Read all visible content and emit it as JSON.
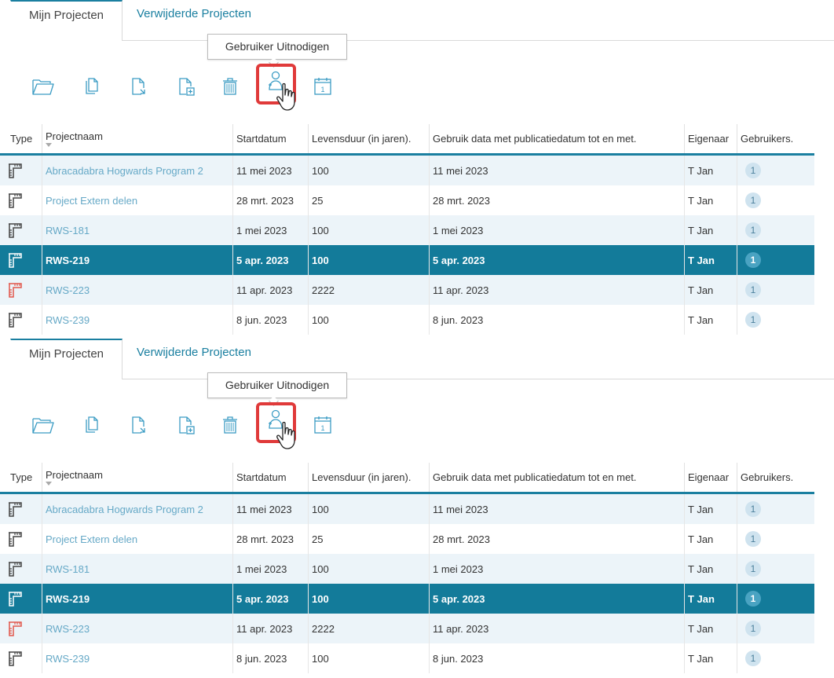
{
  "tabs": {
    "active": "Mijn Projecten",
    "inactive": "Verwijderde Projecten"
  },
  "tooltip": "Gebruiker Uitnodigen",
  "toolbar": [
    "open-folder-icon",
    "copy-icon",
    "export-icon",
    "add-page-icon",
    "trash-icon",
    "invite-user-icon",
    "calendar-icon"
  ],
  "calendar_digit": "1",
  "columns": [
    "Type",
    "Projectnaam",
    "Startdatum",
    "Levensduur (in jaren).",
    "Gebruik data met publicatiedatum tot en met.",
    "Eigenaar",
    "Gebruikers."
  ],
  "rows": [
    {
      "name": "Abracadabra Hogwards Program 2",
      "start": "11 mei 2023",
      "life": "100",
      "pub": "11 mei 2023",
      "owner": "T Jan",
      "users": "1",
      "icon_color": "#444444",
      "selected": false
    },
    {
      "name": "Project Extern delen",
      "start": "28 mrt. 2023",
      "life": "25",
      "pub": "28 mrt. 2023",
      "owner": "T Jan",
      "users": "1",
      "icon_color": "#444444",
      "selected": false
    },
    {
      "name": "RWS-181",
      "start": "1 mei 2023",
      "life": "100",
      "pub": "1 mei 2023",
      "owner": "T Jan",
      "users": "1",
      "icon_color": "#444444",
      "selected": false
    },
    {
      "name": "RWS-219",
      "start": "5 apr. 2023",
      "life": "100",
      "pub": "5 apr. 2023",
      "owner": "T Jan",
      "users": "1",
      "icon_color": "#ffffff",
      "selected": true
    },
    {
      "name": "RWS-223",
      "start": "11 apr. 2023",
      "life": "2222",
      "pub": "11 apr. 2023",
      "owner": "T Jan",
      "users": "1",
      "icon_color": "#e2574c",
      "selected": false
    },
    {
      "name": "RWS-239",
      "start": "8 jun. 2023",
      "life": "100",
      "pub": "8 jun. 2023",
      "owner": "T Jan",
      "users": "1",
      "icon_color": "#444444",
      "selected": false
    }
  ],
  "colors": {
    "accent": "#1a7fa0",
    "selected_row": "#137b9a",
    "link": "#66a9c7",
    "highlight": "#e03a3a"
  }
}
